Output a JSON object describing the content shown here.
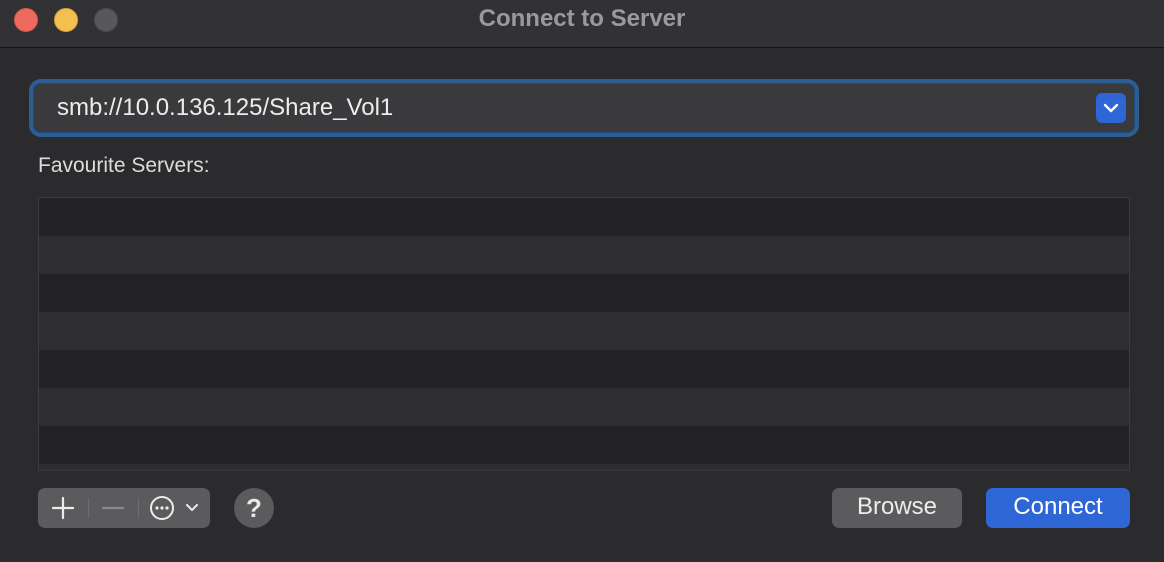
{
  "window": {
    "title": "Connect to Server"
  },
  "server_address": {
    "value": "smb://10.0.136.125/Share_Vol1"
  },
  "favourites": {
    "label": "Favourite Servers:",
    "items": []
  },
  "toolbar": {
    "add_icon": "plus-icon",
    "remove_icon": "minus-icon",
    "action_icon": "ellipsis-circle-icon",
    "help_label": "?"
  },
  "buttons": {
    "browse_label": "Browse",
    "connect_label": "Connect"
  },
  "colors": {
    "accent": "#2f66d6",
    "close": "#ed6a5e",
    "minimize": "#f5bf4f",
    "zoom_inactive": "#58585a",
    "background": "#2b2b2d"
  }
}
